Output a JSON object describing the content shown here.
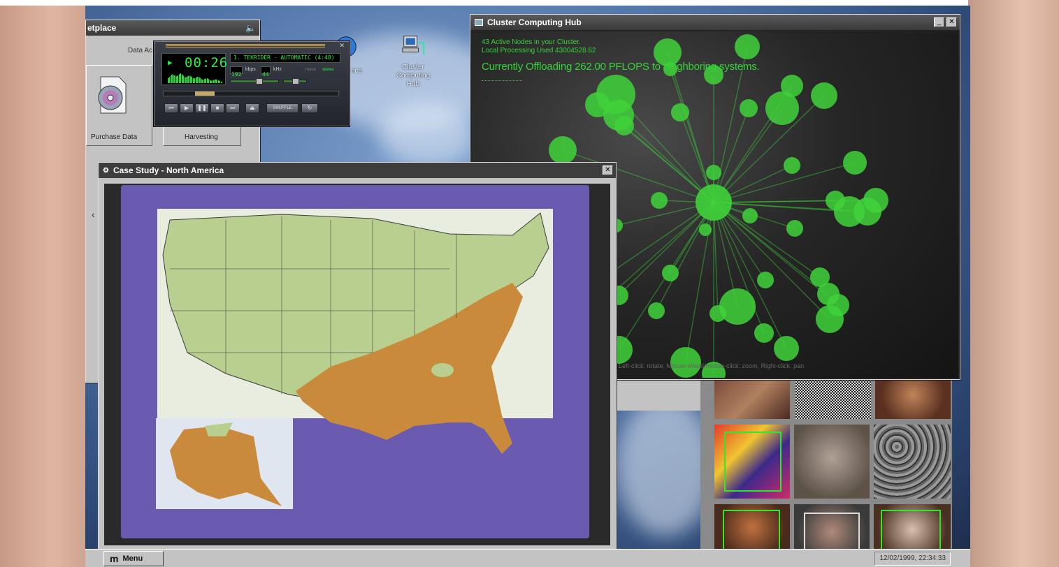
{
  "marketplace": {
    "title": "etplace",
    "subtitle": "Data Ac",
    "items": [
      {
        "label": "Purchase Data"
      },
      {
        "label": "Harvesting"
      }
    ]
  },
  "desktop_icons": [
    {
      "label": "nce",
      "icon": "globe-icon"
    },
    {
      "label": "Cluster Computing Hub",
      "icon": "computer-network-icon"
    }
  ],
  "player": {
    "time": "00:26",
    "track": "1. TEKRIDER - AUTOMATIC (4:48)",
    "kbps": "192",
    "kbps_label": "kbps",
    "khz": "44",
    "khz_label": "kHz",
    "mono": "mono",
    "stereo": "stereo",
    "shuffle_label": "SHUFFLE",
    "position": 0.2,
    "volume": 0.6,
    "balance": 0.5
  },
  "cluster": {
    "title": "Cluster Computing Hub",
    "line1": "43 Active Nodes in your Cluster.",
    "line2": "Local Processing Used 43004528.62",
    "headline": "Currently Offloading 262.00 PFLOPS to neighboring systems.",
    "hint": "Left-click: rotate, Mouse-wheel/middle-click: zoom, Right-click: pan"
  },
  "case_study": {
    "title": "Case Study - North America"
  },
  "taskbar": {
    "menu_label": "Menu",
    "clock": "12/02/1999, 22:34:33"
  },
  "colors": {
    "node_green": "#3fd23a",
    "map_land": "#b8cf90",
    "map_region": "#c98b3b",
    "map_background": "#6a5bb0"
  }
}
